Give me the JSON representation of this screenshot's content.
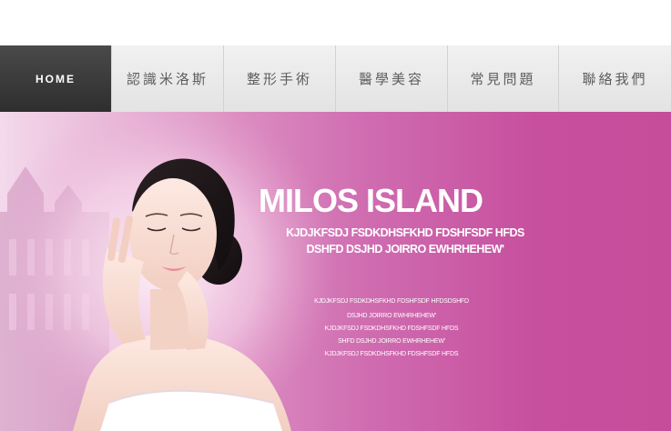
{
  "nav": {
    "items": [
      {
        "label": "HOME"
      },
      {
        "label": "認識米洛斯"
      },
      {
        "label": "整形手術"
      },
      {
        "label": "醫學美容"
      },
      {
        "label": "常見問題"
      },
      {
        "label": "聯絡我們"
      }
    ]
  },
  "hero": {
    "title": "MILOS ISLAND",
    "subtitle_lines": [
      "KJDJKFSDJ FSDKDHSFKHD FDSHFSDF HFDS",
      "DSHFD DSJHD JOIRRO EWHRHEHEW'"
    ],
    "small_lines": [
      "KJDJKFSDJ FSDKDHSFKHD FDSHFSDF HFDSDSHFD",
      "DSJHD JOIRRO EWHRHEHEW'",
      "KJDJKFSDJ FSDKDHSFKHD FDSHFSDF HFDS",
      "SHFD DSJHD JOIRRO EWHRHEHEW'",
      "KJDJKFSDJ FSDKDHSFKHD FDSHFSDF HFDS"
    ]
  },
  "colors": {
    "accent_pink": "#c54d9a",
    "nav_active": "#333333",
    "nav_bg": "#ebebeb"
  }
}
